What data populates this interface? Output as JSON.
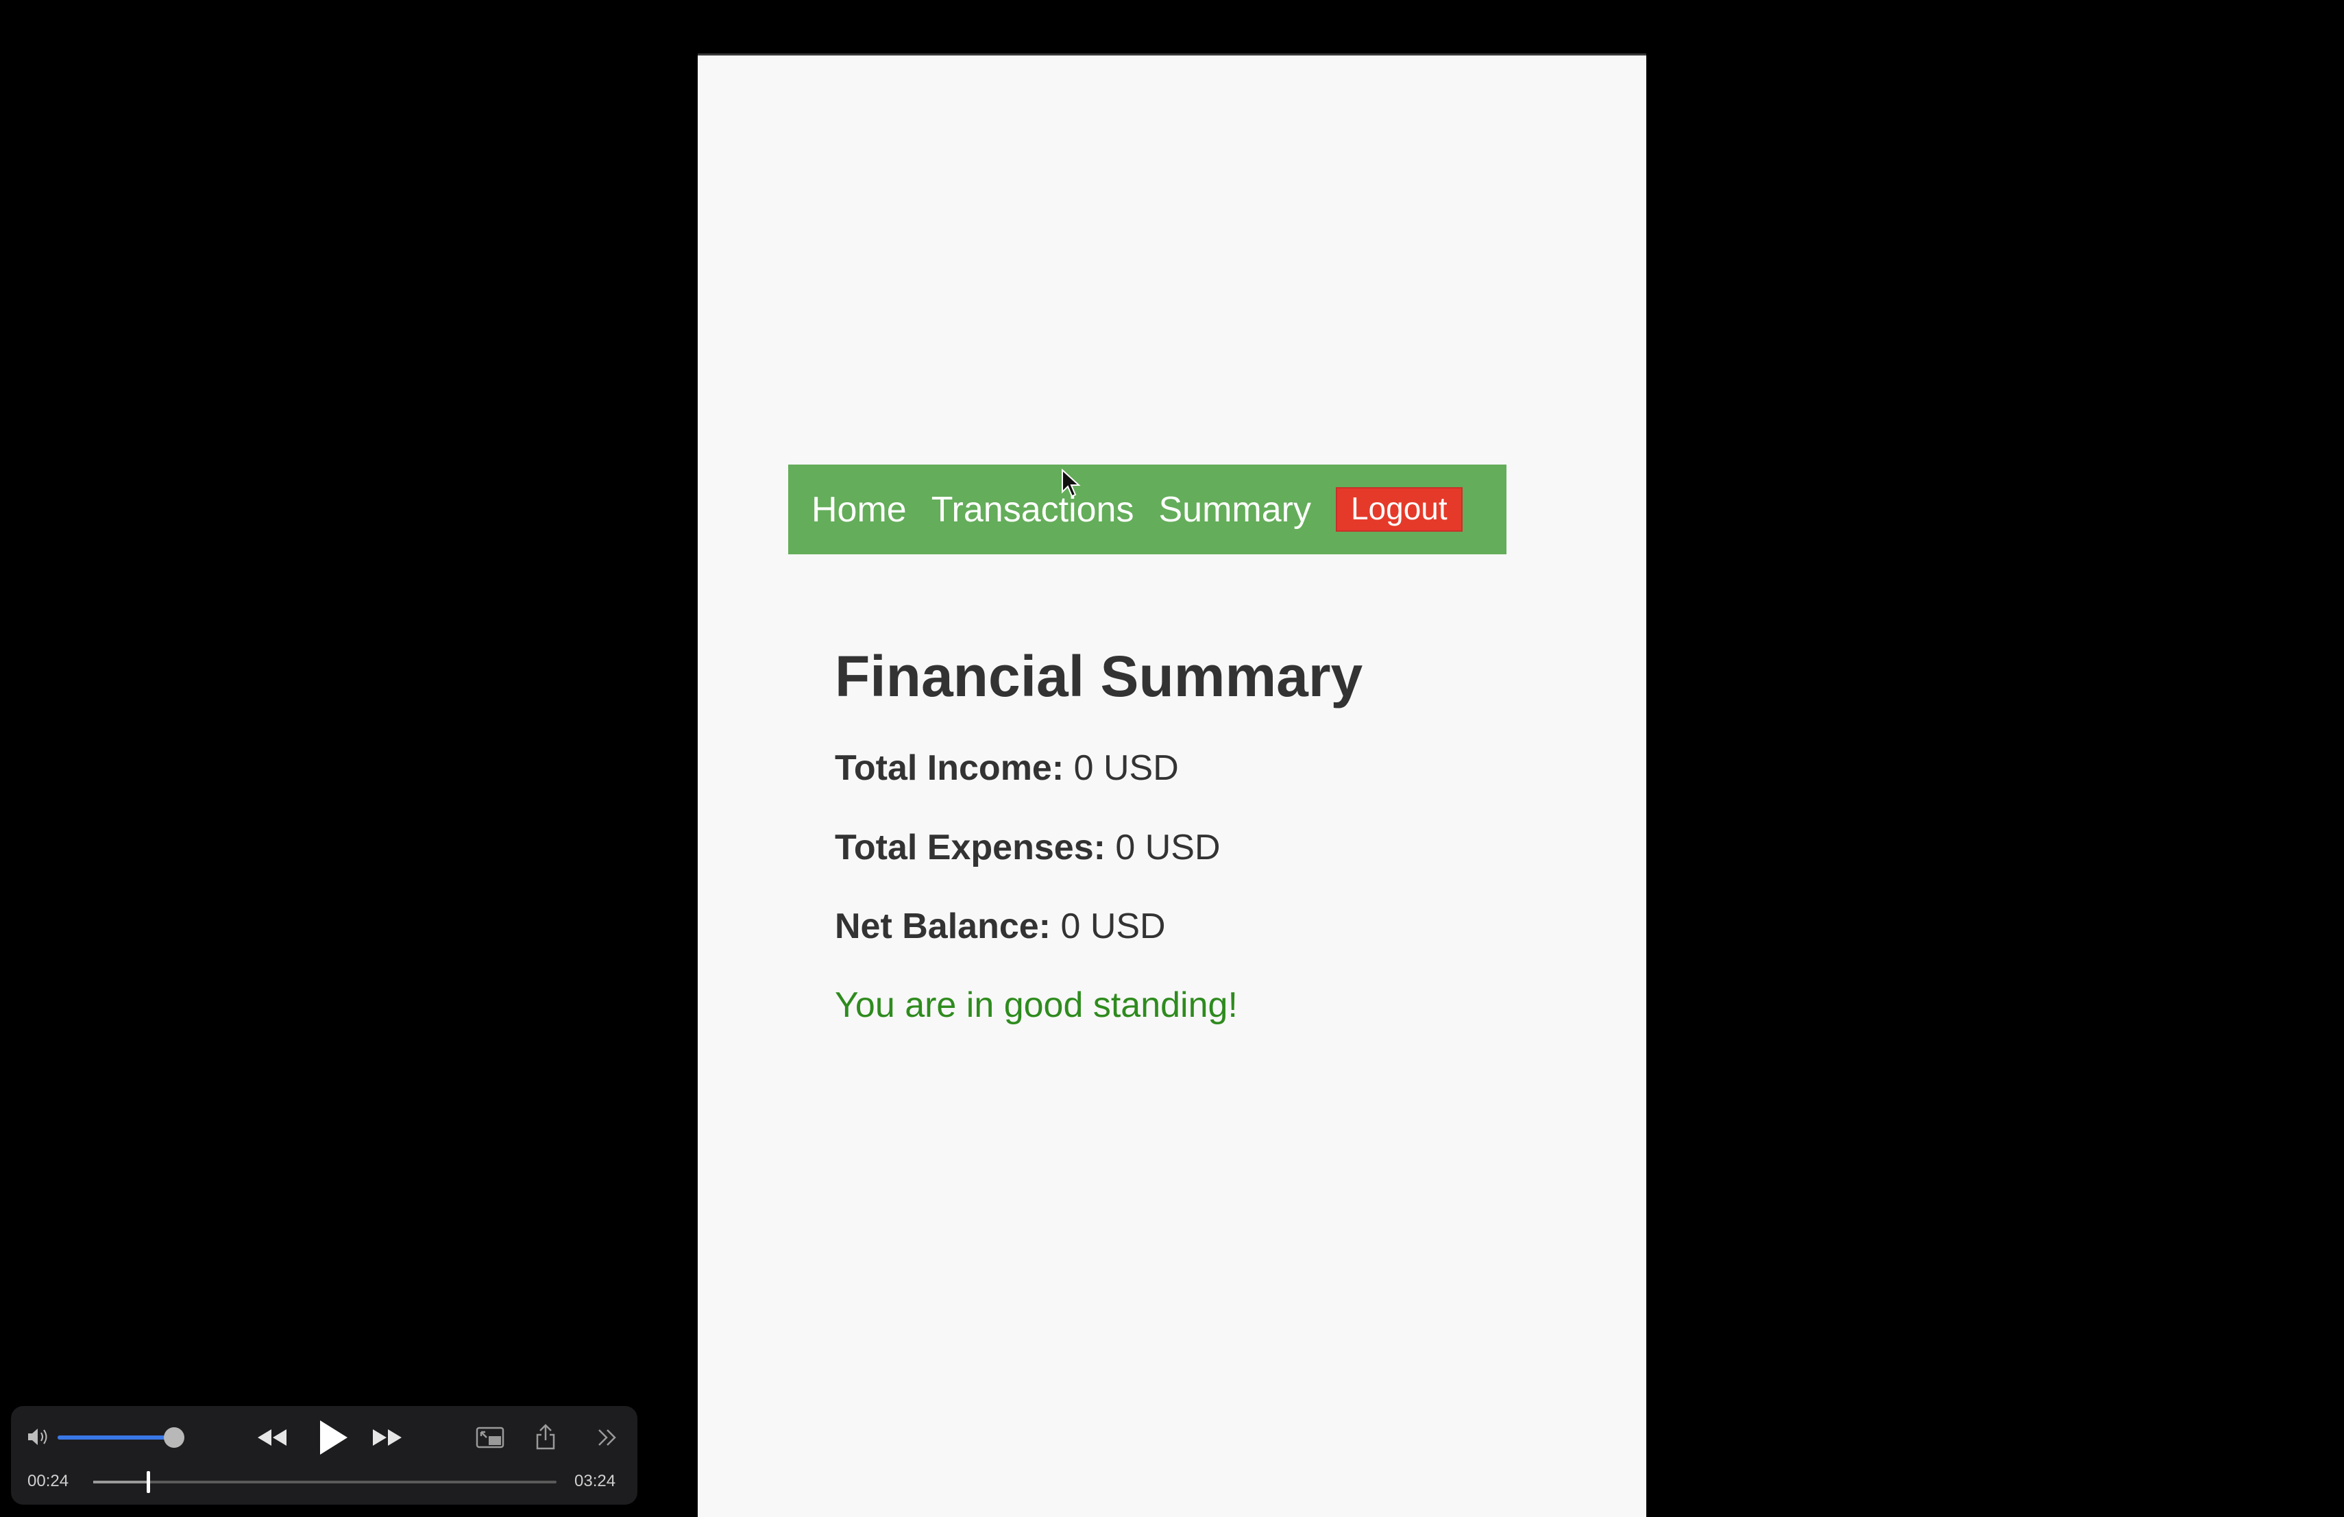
{
  "app": {
    "nav": {
      "home": "Home",
      "transactions": "Transactions",
      "summary": "Summary",
      "logout": "Logout"
    },
    "title": "Financial Summary",
    "stats": {
      "income_label": "Total Income:",
      "income_value": "0 USD",
      "expenses_label": "Total Expenses:",
      "expenses_value": "0 USD",
      "balance_label": "Net Balance:",
      "balance_value": "0 USD"
    },
    "standing_message": "You are in good standing!",
    "colors": {
      "nav_bg": "#64ad5a",
      "logout_bg": "#e53a2a",
      "standing_text": "#2e8b1e"
    }
  },
  "player": {
    "elapsed": "00:24",
    "duration": "03:24",
    "progress_fraction": 0.118,
    "volume_fraction": 1.0,
    "icons": [
      "volume-icon",
      "rewind-icon",
      "play-icon",
      "fast-forward-icon",
      "picture-in-picture-icon",
      "share-icon",
      "more-icon"
    ]
  }
}
